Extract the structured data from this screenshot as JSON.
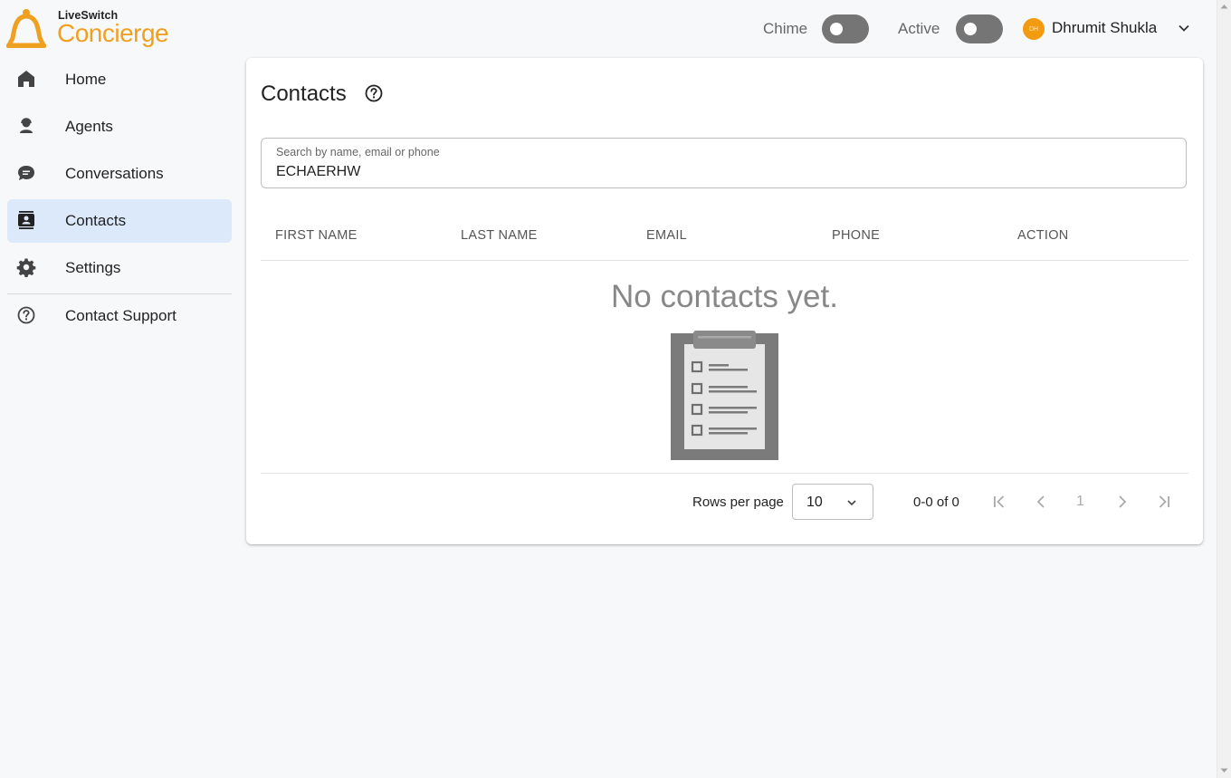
{
  "app": {
    "brand_small": "LiveSwitch",
    "brand_big": "Concierge",
    "accent_color": "#f0a020"
  },
  "topbar": {
    "chime_label": "Chime",
    "active_label": "Active",
    "avatar_initials": "DH",
    "user_name": "Dhrumit Shukla"
  },
  "sidebar": {
    "items": [
      {
        "label": "Home",
        "icon": "home-icon"
      },
      {
        "label": "Agents",
        "icon": "agent-icon"
      },
      {
        "label": "Conversations",
        "icon": "chat-icon"
      },
      {
        "label": "Contacts",
        "icon": "contacts-icon",
        "active": true
      },
      {
        "label": "Settings",
        "icon": "gear-icon"
      },
      {
        "label": "Contact Support",
        "icon": "help-circle-icon"
      }
    ]
  },
  "main": {
    "title": "Contacts",
    "search": {
      "label": "Search by name, email or phone",
      "value": "ECHAERHW"
    },
    "columns": [
      "FIRST NAME",
      "LAST NAME",
      "EMAIL",
      "PHONE",
      "ACTION"
    ],
    "empty_message": "No contacts yet.",
    "pagination": {
      "rows_per_page_label": "Rows per page",
      "rows_per_page": "10",
      "range": "0-0 of 0",
      "page": "1"
    }
  }
}
